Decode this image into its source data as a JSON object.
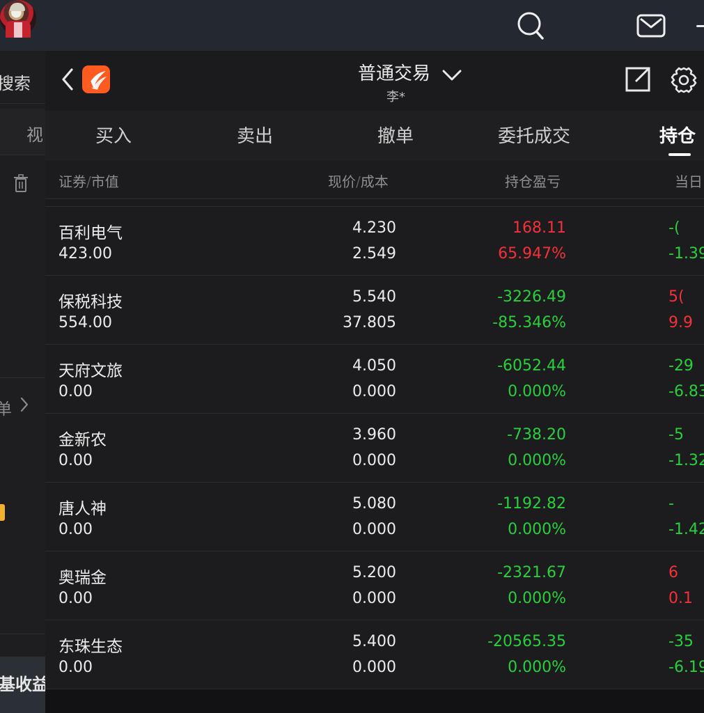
{
  "topbar": {
    "icons": [
      "search-icon",
      "avatar",
      "mail-icon",
      "plus-icon"
    ]
  },
  "left_panel": {
    "search_label": "搜索",
    "view_label": "视",
    "item_label": "单",
    "fund_label": "基收益"
  },
  "nav": {
    "title": "普通交易",
    "subtitle": "李*",
    "icons": [
      "back-icon",
      "app-logo",
      "chevron-down-icon",
      "export-icon",
      "gear-icon"
    ]
  },
  "tabs": [
    {
      "label": "买入",
      "active": false
    },
    {
      "label": "卖出",
      "active": false
    },
    {
      "label": "撤单",
      "active": false
    },
    {
      "label": "委托成交",
      "active": false
    },
    {
      "label": "持仓",
      "active": true
    }
  ],
  "columns": {
    "security": "证券",
    "market_value": "市值",
    "price": "现价",
    "cost": "成本",
    "position_pl": "持仓盈亏",
    "day_pl": "当日"
  },
  "positions": [
    {
      "name": "百利电气",
      "market_value": "423.00",
      "price": "4.230",
      "cost": "2.549",
      "pl": "168.11",
      "pl_pct": "65.947%",
      "pl_dir": "up",
      "day": "-(",
      "day_pct": "-1.39",
      "day_dir": "down"
    },
    {
      "name": "保税科技",
      "market_value": "554.00",
      "price": "5.540",
      "cost": "37.805",
      "pl": "-3226.49",
      "pl_pct": "-85.346%",
      "pl_dir": "down",
      "day": "5(",
      "day_pct": "9.9",
      "day_dir": "up"
    },
    {
      "name": "天府文旅",
      "market_value": "0.00",
      "price": "4.050",
      "cost": "0.000",
      "pl": "-6052.44",
      "pl_pct": "0.000%",
      "pl_dir": "down",
      "day": "-29",
      "day_pct": "-6.83",
      "day_dir": "down"
    },
    {
      "name": "金新农",
      "market_value": "0.00",
      "price": "3.960",
      "cost": "0.000",
      "pl": "-738.20",
      "pl_pct": "0.000%",
      "pl_dir": "down",
      "day": "-5",
      "day_pct": "-1.32",
      "day_dir": "down"
    },
    {
      "name": "唐人神",
      "market_value": "0.00",
      "price": "5.080",
      "cost": "0.000",
      "pl": "-1192.82",
      "pl_pct": "0.000%",
      "pl_dir": "down",
      "day": "-",
      "day_pct": "-1.42",
      "day_dir": "down"
    },
    {
      "name": "奥瑞金",
      "market_value": "0.00",
      "price": "5.200",
      "cost": "0.000",
      "pl": "-2321.67",
      "pl_pct": "0.000%",
      "pl_dir": "down",
      "day": "6",
      "day_pct": "0.1",
      "day_dir": "up"
    },
    {
      "name": "东珠生态",
      "market_value": "0.00",
      "price": "5.400",
      "cost": "0.000",
      "pl": "-20565.35",
      "pl_pct": "0.000%",
      "pl_dir": "down",
      "day": "-35",
      "day_pct": "-6.19",
      "day_dir": "down"
    }
  ],
  "colors": {
    "up": "#f5303a",
    "down": "#27d03c",
    "logo": "#ff5a1f",
    "background": "#1b1b1d"
  }
}
